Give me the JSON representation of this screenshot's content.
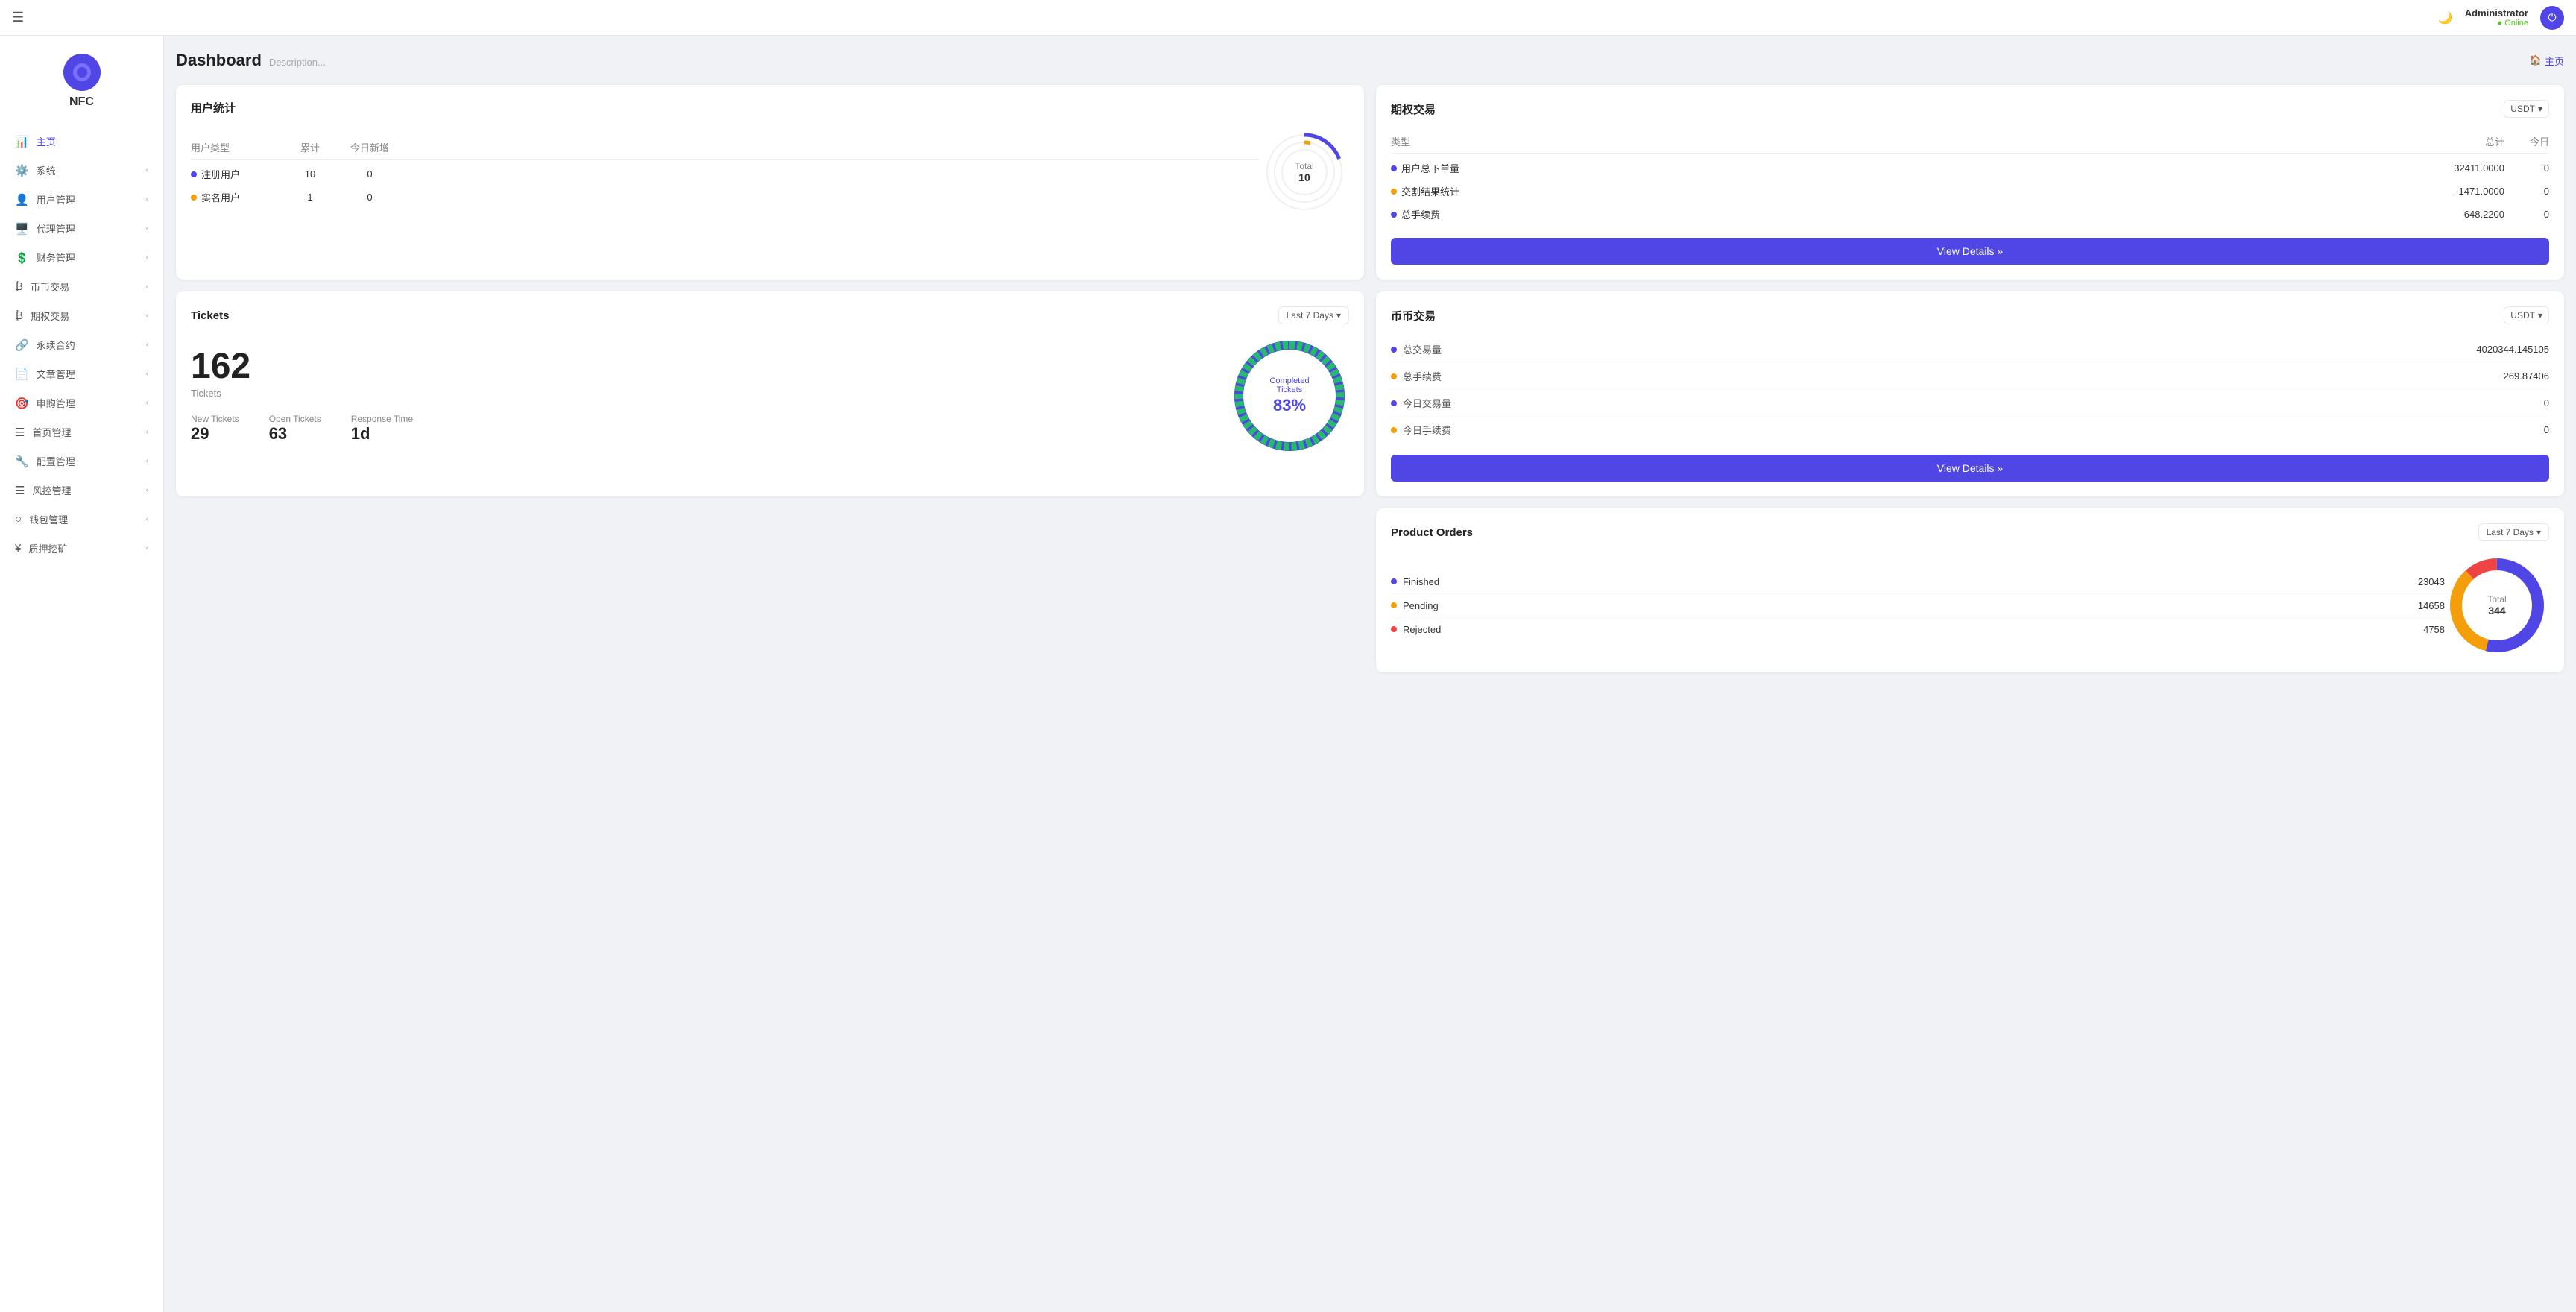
{
  "header": {
    "hamburger_icon": "☰",
    "moon_icon": "🌙",
    "admin_name": "Administrator",
    "admin_status": "● Online",
    "power_icon": "⏻"
  },
  "sidebar": {
    "logo_letter": "🔵",
    "logo_text": "NFC",
    "nav_items": [
      {
        "id": "home",
        "icon": "📊",
        "label": "主页",
        "active": true,
        "has_chevron": false
      },
      {
        "id": "system",
        "icon": "⚙️",
        "label": "系统",
        "active": false,
        "has_chevron": true
      },
      {
        "id": "user-mgmt",
        "icon": "👤",
        "label": "用户管理",
        "active": false,
        "has_chevron": true
      },
      {
        "id": "agent-mgmt",
        "icon": "🖥️",
        "label": "代理管理",
        "active": false,
        "has_chevron": true
      },
      {
        "id": "finance-mgmt",
        "icon": "💲",
        "label": "财务管理",
        "active": false,
        "has_chevron": true
      },
      {
        "id": "currency-trade",
        "icon": "₿",
        "label": "币币交易",
        "active": false,
        "has_chevron": true
      },
      {
        "id": "options-trade",
        "icon": "₿",
        "label": "期权交易",
        "active": false,
        "has_chevron": true
      },
      {
        "id": "perpetual",
        "icon": "🔗",
        "label": "永续合约",
        "active": false,
        "has_chevron": true
      },
      {
        "id": "articles",
        "icon": "📄",
        "label": "文章管理",
        "active": false,
        "has_chevron": true
      },
      {
        "id": "subscription",
        "icon": "🎯",
        "label": "申购管理",
        "active": false,
        "has_chevron": true
      },
      {
        "id": "home-mgmt",
        "icon": "☰",
        "label": "首页管理",
        "active": false,
        "has_chevron": true
      },
      {
        "id": "config-mgmt",
        "icon": "🔧",
        "label": "配置管理",
        "active": false,
        "has_chevron": true
      },
      {
        "id": "risk-mgmt",
        "icon": "☰",
        "label": "风控管理",
        "active": false,
        "has_chevron": true
      },
      {
        "id": "wallet-mgmt",
        "icon": "○",
        "label": "钱包管理",
        "active": false,
        "has_chevron": true
      },
      {
        "id": "mining",
        "icon": "¥",
        "label": "质押挖矿",
        "active": false,
        "has_chevron": true
      }
    ]
  },
  "page": {
    "title": "Dashboard",
    "description": "Description...",
    "breadcrumb_icon": "🏠",
    "breadcrumb_label": "主页"
  },
  "user_stats": {
    "card_title": "用户统计",
    "columns": [
      "用户类型",
      "累计",
      "今日新增"
    ],
    "rows": [
      {
        "dot_color": "#4f46e5",
        "type": "注册用户",
        "total": "10",
        "today": "0"
      },
      {
        "dot_color": "#f59e0b",
        "type": "实名用户",
        "total": "1",
        "today": "0"
      }
    ],
    "donut_label": "Total",
    "donut_value": "10"
  },
  "tickets": {
    "card_title": "Tickets",
    "filter_label": "Last 7 Days",
    "big_number": "162",
    "big_label": "Tickets",
    "completed_label": "Completed Tickets",
    "completed_pct": "83%",
    "stats": [
      {
        "label": "New Tickets",
        "value": "29"
      },
      {
        "label": "Open Tickets",
        "value": "63"
      },
      {
        "label": "Response Time",
        "value": "1d"
      }
    ]
  },
  "options_trading": {
    "card_title": "期权交易",
    "currency": "USDT",
    "columns": [
      "类型",
      "总计",
      "今日"
    ],
    "rows": [
      {
        "dot_color": "#4f46e5",
        "type": "用户总下单量",
        "total": "32411.0000",
        "today": "0"
      },
      {
        "dot_color": "#f59e0b",
        "type": "交割结果统计",
        "total": "-1471.0000",
        "today": "0"
      },
      {
        "dot_color": "#4f46e5",
        "type": "总手续费",
        "total": "648.2200",
        "today": "0"
      }
    ],
    "btn_label": "View Details »"
  },
  "currency_trading": {
    "card_title": "币币交易",
    "currency": "USDT",
    "rows": [
      {
        "dot_color": "#4f46e5",
        "label": "总交易量",
        "value": "4020344.145105"
      },
      {
        "dot_color": "#f59e0b",
        "label": "总手续费",
        "value": "269.87406"
      },
      {
        "dot_color": "#4f46e5",
        "label": "今日交易量",
        "value": "0"
      },
      {
        "dot_color": "#f59e0b",
        "label": "今日手续费",
        "value": "0"
      }
    ],
    "btn_label": "View Details »"
  },
  "product_orders": {
    "card_title": "Product Orders",
    "filter_label": "Last 7 Days",
    "rows": [
      {
        "dot_color": "#4f46e5",
        "label": "Finished",
        "value": "23043"
      },
      {
        "dot_color": "#f59e0b",
        "label": "Pending",
        "value": "14658"
      },
      {
        "dot_color": "#ef4444",
        "label": "Rejected",
        "value": "4758"
      }
    ],
    "donut_label": "Total",
    "donut_value": "344"
  }
}
